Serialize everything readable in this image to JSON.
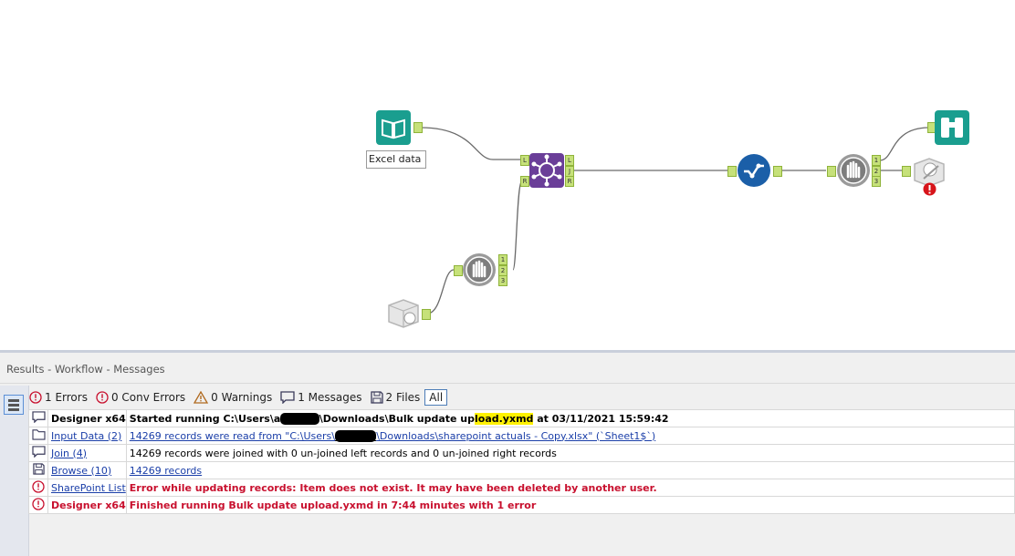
{
  "canvas": {
    "nodes": [
      {
        "id": "excel-input",
        "icon": "book-icon",
        "label": "Excel data",
        "color": "#1a9e8f"
      },
      {
        "id": "join",
        "icon": "join-icon",
        "color": "#6a3e98",
        "anchors_in": [
          "L",
          "R"
        ],
        "anchors_out": [
          "L",
          "J",
          "R"
        ]
      },
      {
        "id": "select",
        "icon": "check-flow-icon",
        "color": "#1b5fa8"
      },
      {
        "id": "sharepoint-input",
        "icon": "sharepoint-icon"
      },
      {
        "id": "block-until-done-1",
        "icon": "hand-gear-icon",
        "anchors_out": [
          "1",
          "2",
          "3"
        ]
      },
      {
        "id": "block-until-done-2",
        "icon": "hand-gear-icon",
        "anchors_out": [
          "1",
          "2",
          "3"
        ]
      },
      {
        "id": "browse",
        "icon": "binoculars-icon",
        "color": "#1a9e8f"
      },
      {
        "id": "sharepoint-output",
        "icon": "sharepoint-output-icon",
        "status": "error"
      }
    ]
  },
  "results": {
    "title": "Results - Workflow - Messages",
    "filters": [
      {
        "icon": "error-icon",
        "label": "1 Errors"
      },
      {
        "icon": "conv-error-icon",
        "label": "0 Conv Errors"
      },
      {
        "icon": "warning-icon",
        "label": "0 Warnings"
      },
      {
        "icon": "message-icon",
        "label": "1 Messages"
      },
      {
        "icon": "file-icon",
        "label": "2 Files"
      },
      {
        "label": "All"
      }
    ],
    "rows": [
      {
        "icon": "message-icon",
        "tool": "Designer x64",
        "tool_style": "bold",
        "msg_parts": [
          {
            "t": "Started running C:\\Users\\",
            "s": "bold"
          },
          {
            "t": "a",
            "s": "bold"
          },
          {
            "t": "XXXXX",
            "s": "bold redact"
          },
          {
            "t": "\\Downloads\\Bulk update up",
            "s": "bold"
          },
          {
            "t": "load.yxmd",
            "s": "bold hl"
          },
          {
            "t": " at 03/11/2021 15:59:42",
            "s": "bold"
          }
        ]
      },
      {
        "icon": "folder-icon",
        "tool": "Input Data (2)",
        "tool_style": "link",
        "msg_parts": [
          {
            "t": "14269 records were read from \"C:\\Users\\",
            "s": "link"
          },
          {
            "t": "XXXXXX",
            "s": "link redact"
          },
          {
            "t": "\\Downloads\\sharepoint actuals - Copy.xlsx\" (`Sheet1$`)",
            "s": "link"
          }
        ]
      },
      {
        "icon": "message-icon",
        "tool": "Join (4)",
        "tool_style": "link",
        "msg_parts": [
          {
            "t": "14269 records were joined with 0 un-joined left records and 0 un-joined right records",
            "s": ""
          }
        ]
      },
      {
        "icon": "file-icon",
        "tool": "Browse (10)",
        "tool_style": "link",
        "msg_parts": [
          {
            "t": "14269 records",
            "s": "link"
          }
        ]
      },
      {
        "icon": "error-icon",
        "tool": "SharePoint List",
        "tool_style": "link",
        "msg_parts": [
          {
            "t": "Error while updating records: Item does not exist. It may have been deleted by another user.",
            "s": "err"
          }
        ]
      },
      {
        "icon": "error-icon",
        "tool": "Designer x64",
        "tool_style": "err",
        "msg_parts": [
          {
            "t": "Finished running Bulk update upload.yxmd in 7:44 minutes with 1 error",
            "s": "err"
          }
        ]
      }
    ],
    "colors": {
      "error": "#c8102e",
      "link": "#1a3ea8",
      "highlight": "#fff200"
    }
  }
}
